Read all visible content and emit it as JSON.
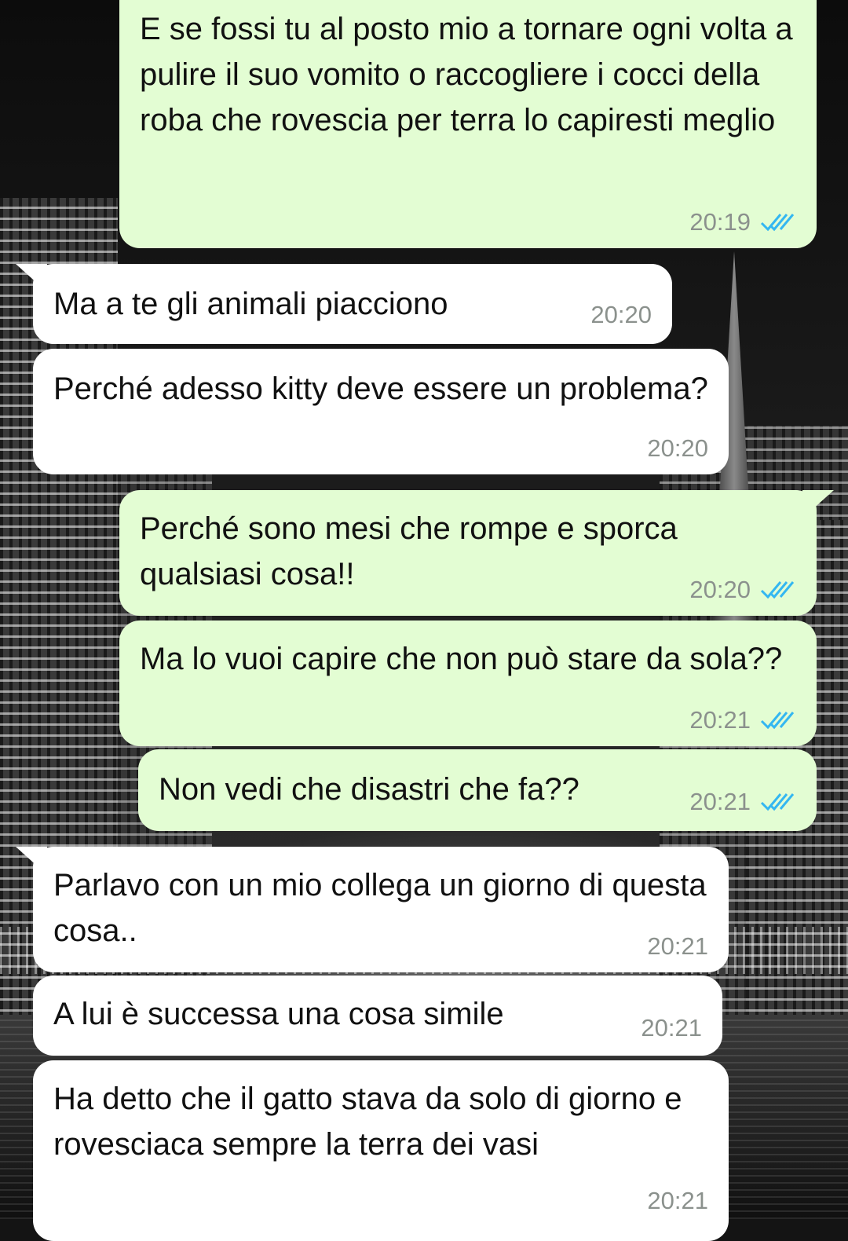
{
  "messages": [
    {
      "id": "m1",
      "direction": "outgoing",
      "text": "E se fossi tu al posto mio a tornare ogni volta a pulire il suo vomito o raccogliere i cocci della roba che rovescia per terra lo capiresti meglio",
      "time": "20:19",
      "status": "read"
    },
    {
      "id": "m2",
      "direction": "incoming",
      "text": "Ma a te gli animali piacciono",
      "time": "20:20"
    },
    {
      "id": "m3",
      "direction": "incoming",
      "text": "Perché adesso kitty deve essere un problema?",
      "time": "20:20"
    },
    {
      "id": "m4",
      "direction": "outgoing",
      "text": "Perché sono mesi che rompe e sporca qualsiasi cosa!!",
      "time": "20:20",
      "status": "read"
    },
    {
      "id": "m5",
      "direction": "outgoing",
      "text": "Ma lo vuoi capire che non può stare da sola??",
      "time": "20:21",
      "status": "read"
    },
    {
      "id": "m6",
      "direction": "outgoing",
      "text": "Non vedi che disastri che fa??",
      "time": "20:21",
      "status": "read"
    },
    {
      "id": "m7",
      "direction": "incoming",
      "text": "Parlavo con un mio collega un giorno di questa cosa..",
      "time": "20:21"
    },
    {
      "id": "m8",
      "direction": "incoming",
      "text": "A lui è successa una cosa simile",
      "time": "20:21"
    },
    {
      "id": "m9",
      "direction": "incoming",
      "text": "Ha detto che il gatto stava da solo di giorno e rovesciaca sempre la terra dei vasi",
      "time": "20:21"
    }
  ],
  "colors": {
    "incoming_bubble": "#ffffff",
    "outgoing_bubble": "#e3fdd3",
    "read_ticks": "#34b7f1",
    "timestamp": "#8b918d"
  },
  "icons": {
    "read_receipt": "double-check-icon"
  }
}
